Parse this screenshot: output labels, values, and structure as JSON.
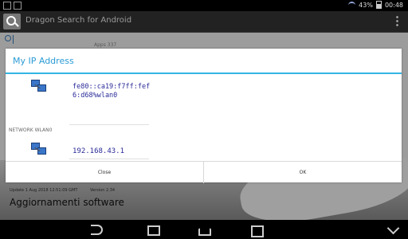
{
  "status_bar": {
    "battery": "43%",
    "time": "00:48"
  },
  "app": {
    "title": "Dragon Search for Android"
  },
  "background": {
    "apps_label": "Apps 337",
    "update_info": "Update 1 Aug 2018 12:51:09 GMT",
    "version": "Version 2.34",
    "section_title": "Aggiornamenti software"
  },
  "dialog": {
    "title": "My IP Address",
    "ipv6": "fe80::ca19:f7ff:fef6:d68%wlan0",
    "network_label": "NETWORK WLAN0",
    "ipv4": "192.168.43.1",
    "buttons": {
      "close": "Close",
      "ok": "OK"
    }
  },
  "colors": {
    "accent": "#33b5e5",
    "ip_text": "#2a2a9a"
  }
}
